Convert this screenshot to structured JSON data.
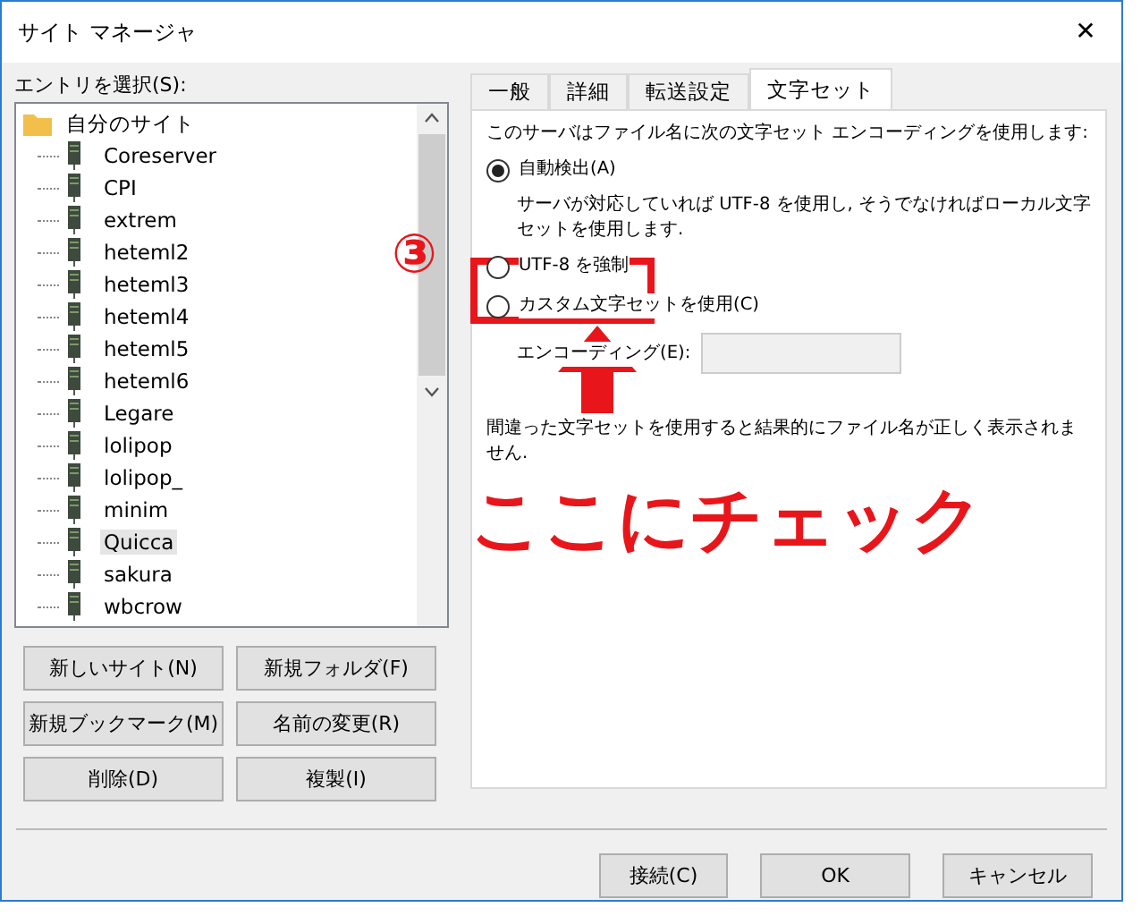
{
  "window": {
    "title": "サイト マネージャ",
    "close": "✕"
  },
  "entry_label": "エントリを選択(S):",
  "tree": {
    "label": "自分のサイト",
    "children": [
      {
        "label": "Coreserver",
        "selected": false
      },
      {
        "label": "CPI",
        "selected": false
      },
      {
        "label": "extrem",
        "selected": false
      },
      {
        "label": "heteml2",
        "selected": false
      },
      {
        "label": "heteml3",
        "selected": false
      },
      {
        "label": "heteml4",
        "selected": false
      },
      {
        "label": "heteml5",
        "selected": false
      },
      {
        "label": "heteml6",
        "selected": false
      },
      {
        "label": "Legare",
        "selected": false
      },
      {
        "label": "lolipop",
        "selected": false
      },
      {
        "label": "lolipop_",
        "selected": false
      },
      {
        "label": "minim",
        "selected": false
      },
      {
        "label": "Quicca",
        "selected": true
      },
      {
        "label": "sakura",
        "selected": false
      },
      {
        "label": "wbcrow",
        "selected": false
      }
    ]
  },
  "site_buttons": [
    "新しいサイト(N)",
    "新規フォルダ(F)",
    "新規ブックマーク(M)",
    "名前の変更(R)",
    "削除(D)",
    "複製(I)"
  ],
  "tabs": [
    {
      "label": "一般",
      "selected": false
    },
    {
      "label": "詳細",
      "selected": false
    },
    {
      "label": "転送設定",
      "selected": false
    },
    {
      "label": "文字セット",
      "selected": true
    }
  ],
  "charset": {
    "intro": "このサーバはファイル名に次の文字セット エンコーディングを使用します:",
    "options": [
      {
        "label": "自動検出(A)",
        "selected": true,
        "note": "サーバが対応していれば UTF-8 を使用し, そうでなければローカル文字セットを使用します."
      },
      {
        "label": "UTF-8 を強制",
        "selected": false
      },
      {
        "label": "カスタム文字セットを使用(C)",
        "selected": false
      }
    ],
    "encoding_label": "エンコーディング(E):",
    "warning": "間違った文字セットを使用すると結果的にファイル名が正しく表示されません."
  },
  "dialog_buttons": [
    "接続(C)",
    "OK",
    "キャンセル"
  ],
  "annotation": {
    "step": "③",
    "caption": "ここにチェック"
  }
}
